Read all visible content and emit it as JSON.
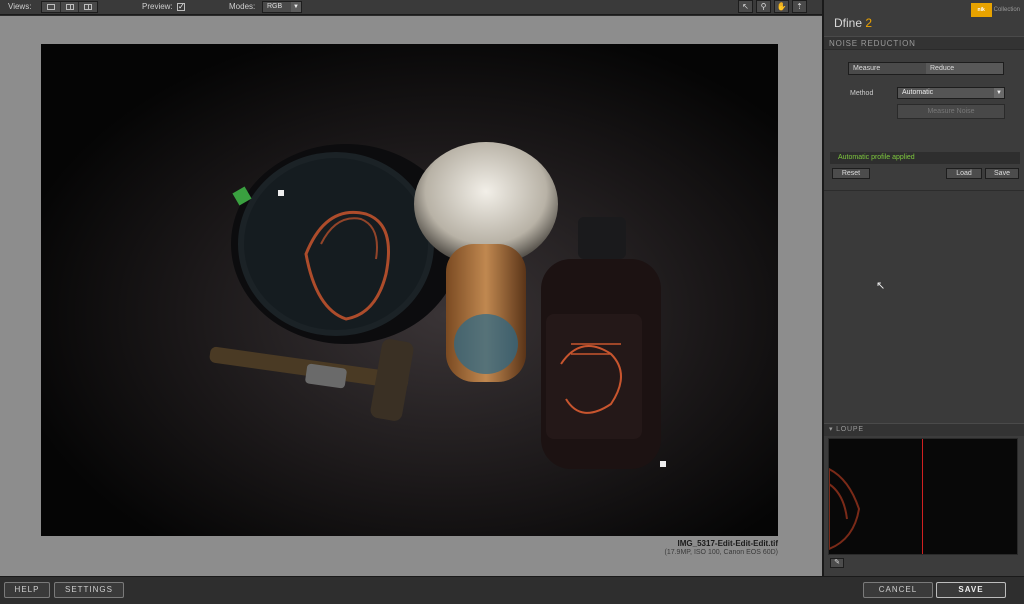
{
  "toolbar": {
    "views_label": "Views:",
    "preview_label": "Preview:",
    "preview_checked": true,
    "modes_label": "Modes:",
    "mode_value": "RGB",
    "tools": [
      "pointer-icon",
      "zoom-icon",
      "hand-icon",
      "pin-icon"
    ]
  },
  "canvas": {
    "filename": "IMG_5317-Edit-Edit-Edit.tif",
    "fileinfo": "(17.9MP, ISO 100, Canon EOS 60D)"
  },
  "panel": {
    "app_name": "Dfine",
    "app_version": "2",
    "brand": "Collection",
    "noise_reduction_title": "NOISE REDUCTION",
    "tabs": [
      {
        "label": "Measure",
        "active": false
      },
      {
        "label": "Reduce",
        "active": true
      }
    ],
    "method_label": "Method",
    "method_value": "Automatic",
    "measure_noise_label": "Measure Noise",
    "status_text": "Automatic profile applied",
    "reset_label": "Reset",
    "load_label": "Load",
    "save_label": "Save",
    "loupe_title": "LOUPE"
  },
  "bottom": {
    "help_label": "HELP",
    "settings_label": "SETTINGS",
    "cancel_label": "CANCEL",
    "save_label": "SAVE"
  },
  "colors": {
    "accent": "#f0a500",
    "status_green": "#7ec83e",
    "loupe_line": "#d02020"
  }
}
